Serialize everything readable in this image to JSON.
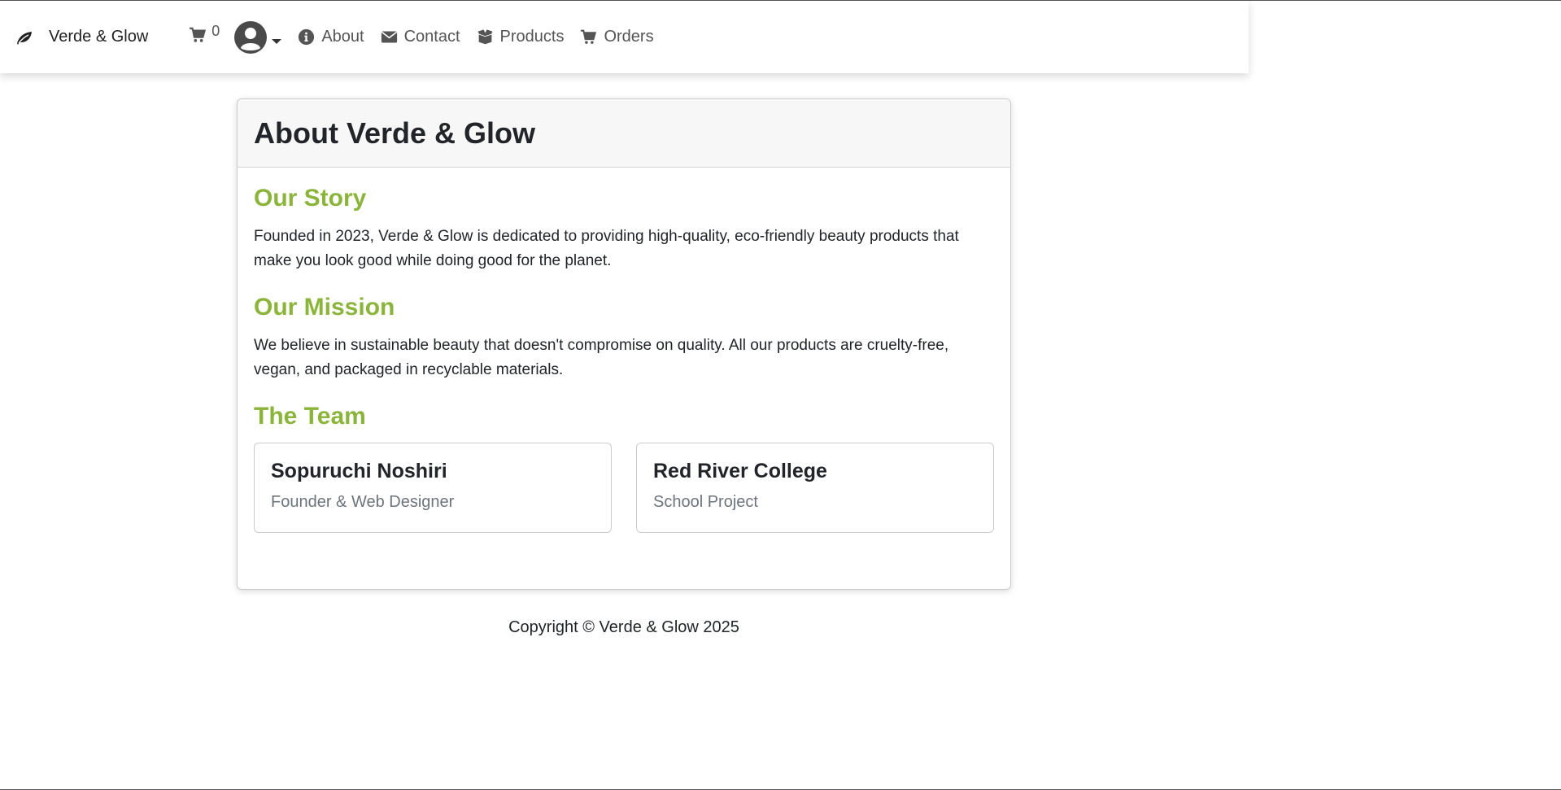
{
  "navbar": {
    "brand_label": "Verde & Glow",
    "cart_count": "0",
    "links": [
      {
        "label": "About",
        "icon": "info-circle-icon"
      },
      {
        "label": "Contact",
        "icon": "envelope-icon"
      },
      {
        "label": "Products",
        "icon": "box-open-icon"
      },
      {
        "label": "Orders",
        "icon": "shopping-cart-icon"
      }
    ]
  },
  "card": {
    "title": "About Verde & Glow",
    "sections": [
      {
        "heading": "Our Story",
        "text": "Founded in 2023, Verde & Glow is dedicated to providing high-quality, eco-friendly beauty products that make you look good while doing good for the planet."
      },
      {
        "heading": "Our Mission",
        "text": "We believe in sustainable beauty that doesn't compromise on quality. All our products are cruelty-free, vegan, and packaged in recyclable materials."
      }
    ],
    "team_heading": "The Team",
    "team": [
      {
        "name": "Sopuruchi Noshiri",
        "role": "Founder & Web Designer"
      },
      {
        "name": "Red River College",
        "role": "School Project"
      }
    ]
  },
  "footer": {
    "copyright": "Copyright © Verde & Glow 2025"
  },
  "colors": {
    "accent_green": "#8ab53a",
    "text": "#212529",
    "muted": "#6c757d"
  }
}
